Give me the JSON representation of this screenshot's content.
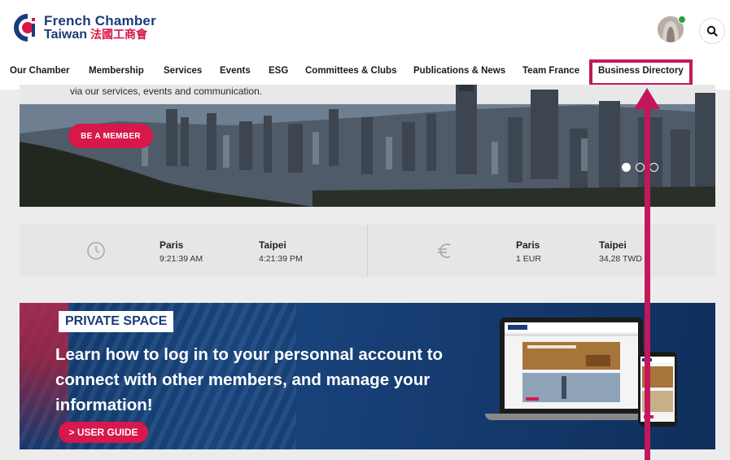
{
  "header": {
    "logo_line1": "French Chamber",
    "logo_line2": "Taiwan",
    "logo_cn": "法國工商會"
  },
  "nav": {
    "items": [
      {
        "label": "Our Chamber"
      },
      {
        "label": "Membership"
      },
      {
        "label": "Services"
      },
      {
        "label": "Events"
      },
      {
        "label": "ESG"
      },
      {
        "label": "Committees & Clubs"
      },
      {
        "label": "Publications & News"
      },
      {
        "label": "Team France"
      },
      {
        "label": "Business Directory"
      }
    ],
    "highlighted": "Business Directory"
  },
  "hero": {
    "subtitle": "via our services, events and communication.",
    "cta_label": "BE A MEMBER",
    "slide_count": 3,
    "active_slide": 1
  },
  "clock": {
    "icon": "clock-icon",
    "cities": [
      {
        "city": "Paris",
        "value": "9:21:39 AM"
      },
      {
        "city": "Taipei",
        "value": "4:21:39 PM"
      }
    ]
  },
  "currency": {
    "icon": "euro-icon",
    "cities": [
      {
        "city": "Paris",
        "value": "1 EUR"
      },
      {
        "city": "Taipei",
        "value": "34,28 TWD"
      }
    ]
  },
  "banner": {
    "label": "PRIVATE SPACE",
    "text": "Learn how to log in to your personnal account to connect with other members, and manage your information!",
    "cta_label": "> USER GUIDE"
  },
  "colors": {
    "brand_blue": "#1d3b7a",
    "brand_red": "#d8174b",
    "annotation": "#c2185b"
  }
}
